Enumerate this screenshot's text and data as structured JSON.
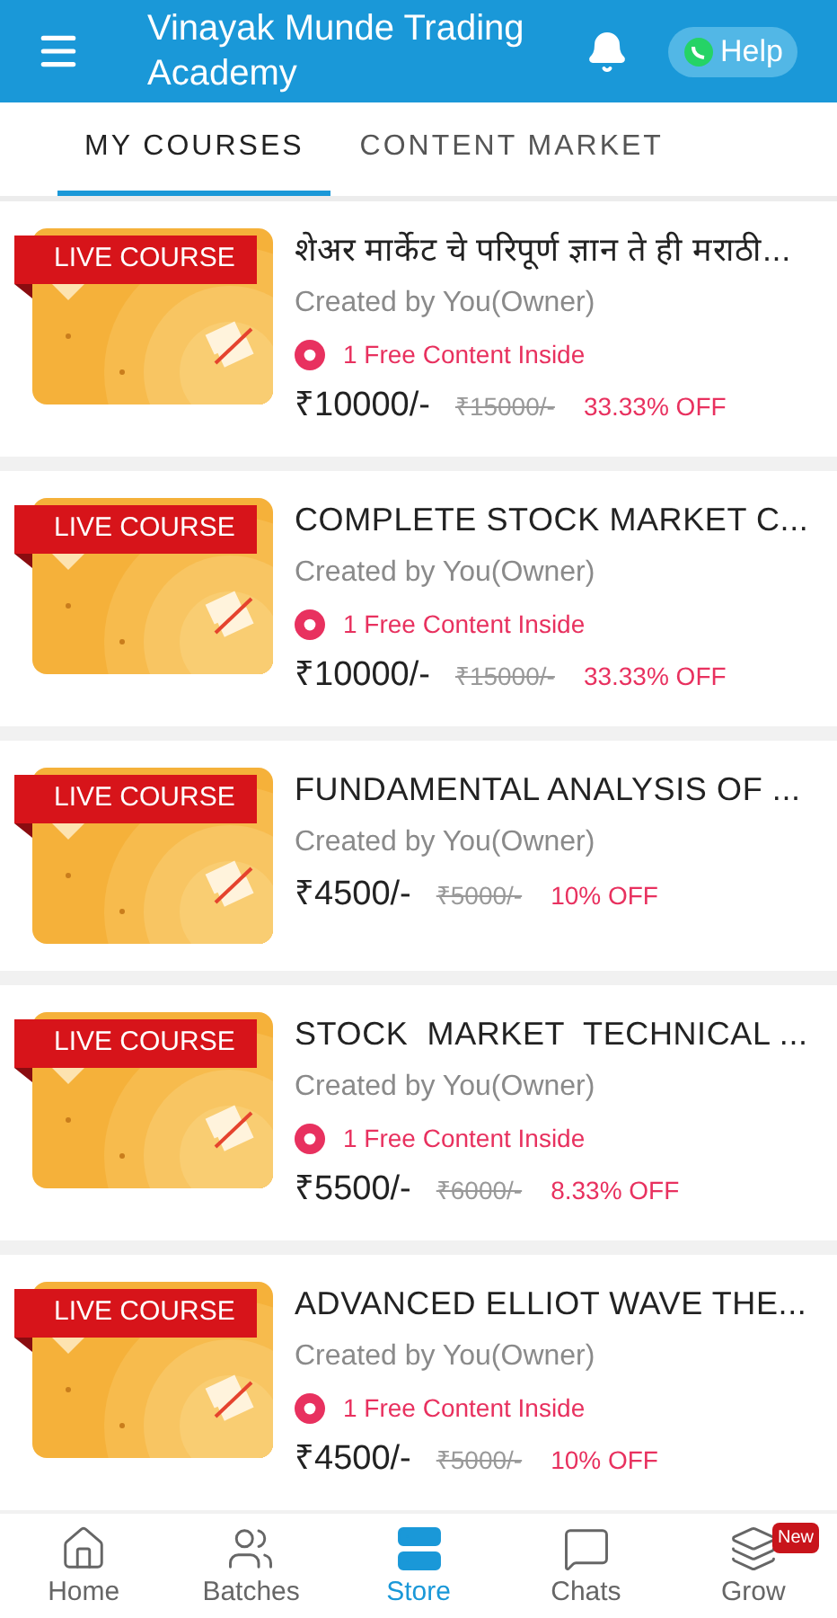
{
  "header": {
    "title": "Vinayak Munde Trading Academy",
    "help": "Help"
  },
  "tabs": [
    {
      "label": "MY COURSES",
      "selected": true
    },
    {
      "label": "CONTENT MARKET",
      "selected": false
    }
  ],
  "courses": [
    {
      "badge": "LIVE COURSE",
      "title": "शेअर मार्केट चे परिपूर्ण ज्ञान ते ही मराठी...",
      "creator": "Created by You(Owner)",
      "free_content": "1 Free Content Inside",
      "price": "₹10000/-",
      "original_price": "₹15000/-",
      "discount": "33.33% OFF"
    },
    {
      "badge": "LIVE COURSE",
      "title": "COMPLETE STOCK MARKET C...",
      "creator": "Created by You(Owner)",
      "free_content": "1 Free Content Inside",
      "price": "₹10000/-",
      "original_price": "₹15000/-",
      "discount": "33.33% OFF"
    },
    {
      "badge": "LIVE COURSE",
      "title": "FUNDAMENTAL ANALYSIS OF ...",
      "creator": "Created by You(Owner)",
      "price": "₹4500/-",
      "original_price": "₹5000/-",
      "discount": "10% OFF"
    },
    {
      "badge": "LIVE COURSE",
      "title": "STOCK  MARKET  TECHNICAL ...",
      "creator": "Created by You(Owner)",
      "free_content": "1 Free Content Inside",
      "price": "₹5500/-",
      "original_price": "₹6000/-",
      "discount": "8.33% OFF"
    },
    {
      "badge": "LIVE COURSE",
      "title": "ADVANCED ELLIOT WAVE THE...",
      "creator": "Created by You(Owner)",
      "free_content": "1 Free Content Inside",
      "price": "₹4500/-",
      "original_price": "₹5000/-",
      "discount": "10% OFF"
    }
  ],
  "bottom_nav": [
    {
      "kind": "home",
      "label": "Home",
      "selected": false
    },
    {
      "kind": "batches",
      "label": "Batches",
      "selected": false
    },
    {
      "kind": "store",
      "label": "Store",
      "selected": true
    },
    {
      "kind": "chats",
      "label": "Chats",
      "selected": false
    },
    {
      "kind": "grow",
      "label": "Grow",
      "selected": false,
      "badge": "New"
    }
  ]
}
